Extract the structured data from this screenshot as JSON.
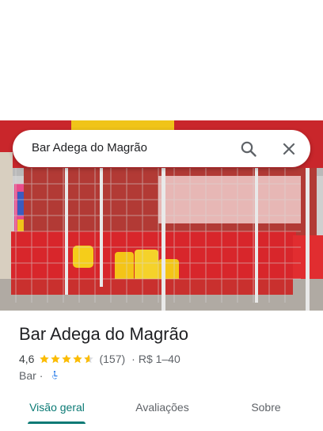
{
  "search": {
    "query": "Bar Adega do Magrão"
  },
  "place": {
    "title": "Bar Adega do Magrão",
    "rating": "4,6",
    "stars": 4.6,
    "reviews": "(157)",
    "separator": "·",
    "price": "R$ 1–40",
    "category": "Bar",
    "category_separator": "·"
  },
  "tabs": [
    {
      "label": "Visão geral",
      "active": true
    },
    {
      "label": "Avaliações",
      "active": false
    },
    {
      "label": "Sobre",
      "active": false
    }
  ],
  "colors": {
    "accent": "#0b7a75",
    "star": "#fbbc04",
    "accessible": "#1a73e8"
  },
  "icons": [
    "search-icon",
    "close-icon",
    "star-icon",
    "accessible-icon"
  ]
}
